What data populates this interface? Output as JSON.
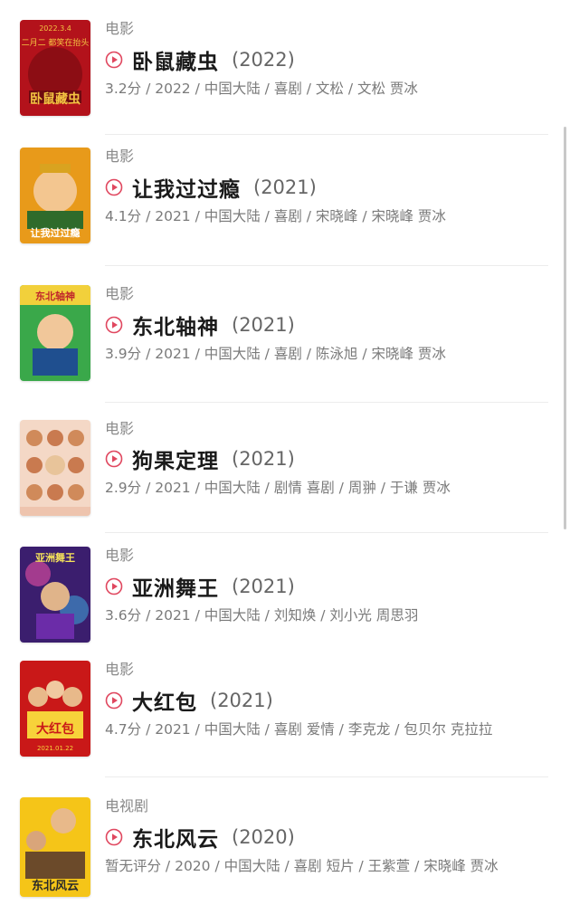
{
  "items": [
    {
      "category": "电影",
      "title": "卧鼠藏虫",
      "year": "(2022)",
      "meta": "3.2分 / 2022 / 中国大陆 / 喜剧 / 文松 / 文松 贾冰",
      "poster_text": "卧鼠藏虫",
      "poster_top_text": "2022.3.4",
      "poster_sub_text": "二月二 都笑在抬头",
      "colors": {
        "bg": "#b3121b",
        "accent": "#f4c542"
      }
    },
    {
      "category": "电影",
      "title": "让我过过瘾",
      "year": "(2021)",
      "meta": "4.1分 / 2021 / 中国大陆 / 喜剧 / 宋晓峰 / 宋晓峰 贾冰",
      "poster_text": "让我过过瘾",
      "colors": {
        "bg": "#e89a1a",
        "accent": "#2f6b2b"
      }
    },
    {
      "category": "电影",
      "title": "东北轴神",
      "year": "(2021)",
      "meta": "3.9分 / 2021 / 中国大陆 / 喜剧 / 陈泳旭 / 宋晓峰 贾冰",
      "poster_text": "东北轴神",
      "colors": {
        "bg": "#3aa84a",
        "accent": "#f2d03b"
      }
    },
    {
      "category": "电影",
      "title": "狗果定理",
      "year": "(2021)",
      "meta": "2.9分 / 2021 / 中国大陆 / 剧情 喜剧 / 周翀 / 于谦 贾冰",
      "poster_text": "",
      "colors": {
        "bg": "#f4d8c6",
        "accent": "#d08a5a"
      }
    },
    {
      "category": "电影",
      "title": "亚洲舞王",
      "year": "(2021)",
      "meta": "3.6分 / 2021 / 中国大陆 / 刘知焕 / 刘小光 周思羽",
      "poster_text": "亚洲舞王",
      "colors": {
        "bg": "#3b1e6e",
        "accent": "#e94ea3"
      }
    },
    {
      "category": "电影",
      "title": "大红包",
      "year": "(2021)",
      "meta": "4.7分 / 2021 / 中国大陆 / 喜剧 爱情 / 李克龙 / 包贝尔 克拉拉",
      "poster_text": "大红包",
      "poster_top_text": "2021.01.22",
      "colors": {
        "bg": "#c91818",
        "accent": "#f7d23a"
      }
    },
    {
      "category": "电视剧",
      "title": "东北风云",
      "year": "(2020)",
      "meta": "暂无评分 / 2020 / 中国大陆 / 喜剧 短片 / 王紫萱 / 宋晓峰 贾冰",
      "poster_text": "东北风云",
      "colors": {
        "bg": "#f5c518",
        "accent": "#6b4a2a"
      }
    }
  ],
  "play_icon_color": "#e0475f"
}
